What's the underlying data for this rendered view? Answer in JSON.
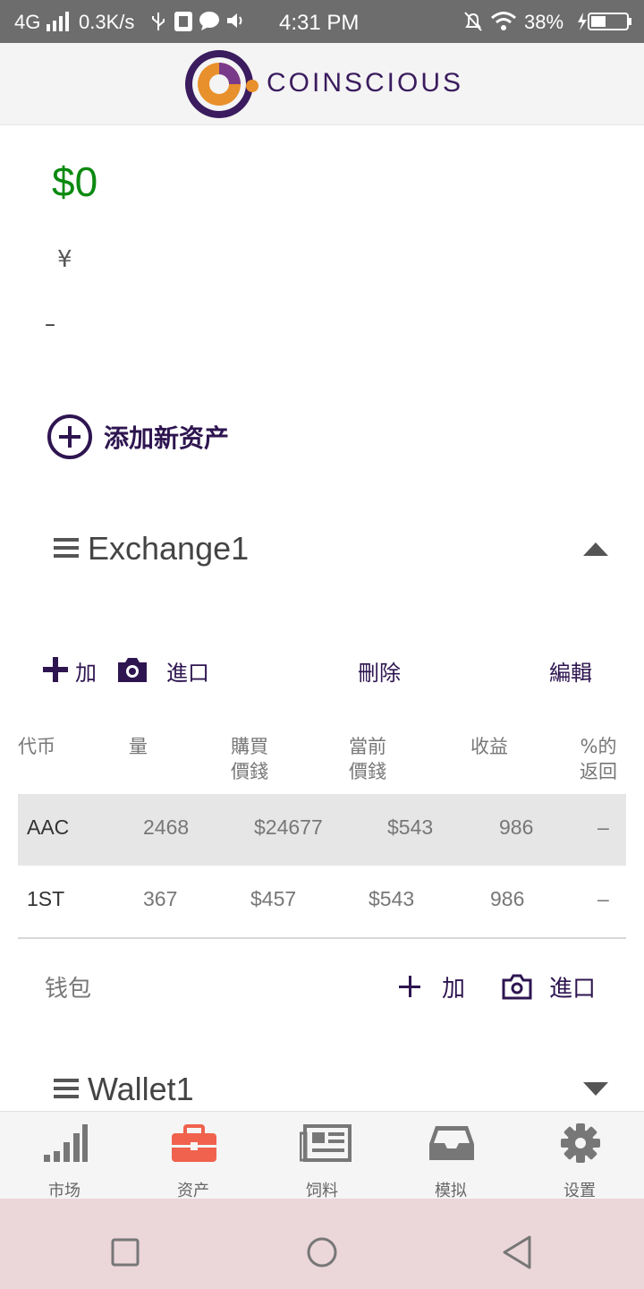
{
  "status_bar": {
    "network": "4G",
    "speed": "0.3K/s",
    "time": "4:31 PM",
    "battery": "38%"
  },
  "header": {
    "brand": "COINSCIOUS"
  },
  "summary": {
    "total_usd": "$0",
    "currency_symbol": "¥",
    "change": "–"
  },
  "add_asset_label": "添加新资产",
  "exchange": {
    "title": "Exchange1",
    "add_label": "加",
    "import_label": "進口",
    "delete_label": "刪除",
    "edit_label": "編輯",
    "columns": {
      "coin": "代币",
      "amount": "量",
      "buy_price_1": "購買",
      "buy_price_2": "價錢",
      "current_price_1": "當前",
      "current_price_2": "價錢",
      "profit": "收益",
      "return_1": "%的",
      "return_2": "返回"
    },
    "rows": [
      {
        "coin": "AAC",
        "amount": "2468",
        "buy_price": "$24677",
        "current_price": "$543",
        "profit": "986",
        "return": "–"
      },
      {
        "coin": "1ST",
        "amount": "367",
        "buy_price": "$457",
        "current_price": "$543",
        "profit": "986",
        "return": "–"
      }
    ]
  },
  "wallet_section": {
    "label": "钱包",
    "add_label": "加",
    "import_label": "進口",
    "wallet_title": "Wallet1"
  },
  "bottom_nav": {
    "items": [
      {
        "label": "市场",
        "icon": "signal-bars-icon"
      },
      {
        "label": "资产",
        "icon": "briefcase-icon"
      },
      {
        "label": "饲料",
        "icon": "newspaper-icon"
      },
      {
        "label": "模拟",
        "icon": "inbox-tray-icon"
      },
      {
        "label": "设置",
        "icon": "gear-icon"
      }
    ],
    "active_color": "#f0624d"
  },
  "colors": {
    "brand_purple": "#2e1550",
    "positive_green": "#0b8a10"
  }
}
